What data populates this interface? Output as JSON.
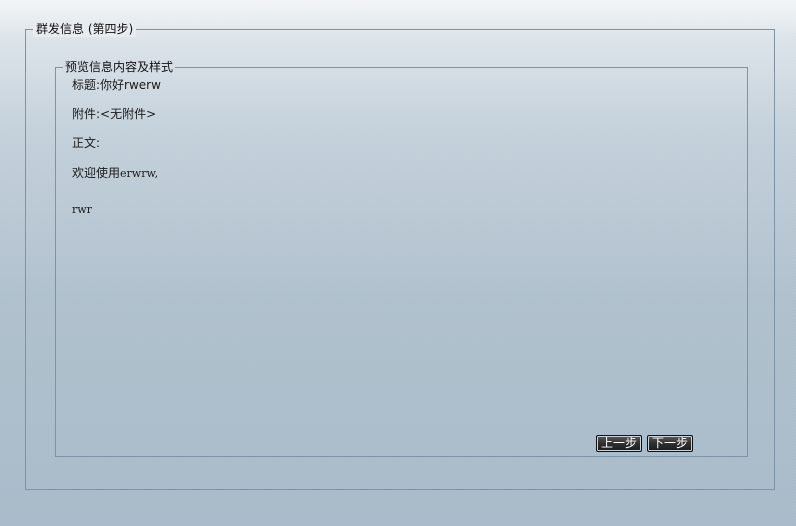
{
  "outer_group": {
    "legend": "群发信息 (第四步)"
  },
  "preview_group": {
    "legend": "预览信息内容及样式",
    "title_label": "标题:",
    "title_value": "你好rwerw",
    "attachment_label": "附件:",
    "attachment_value": "<无附件>",
    "body_label": "正文:",
    "greeting_prefix": "欢迎使用",
    "greeting_value": "erwrw,",
    "body_text": "rwr"
  },
  "buttons": {
    "prev_label": "上一步",
    "next_label": "下一步"
  }
}
